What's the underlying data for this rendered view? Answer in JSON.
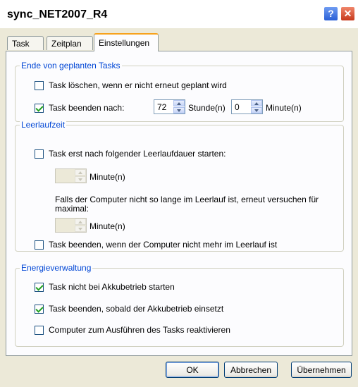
{
  "window": {
    "title": "sync_NET2007_R4",
    "help_label": "?",
    "close_label": "✕"
  },
  "tabs": [
    {
      "label": "Task"
    },
    {
      "label": "Zeitplan"
    },
    {
      "label": "Einstellungen"
    }
  ],
  "group_end": {
    "legend": "Ende von geplanten Tasks",
    "delete_label": "Task löschen, wenn er nicht erneut geplant wird",
    "delete_checked": false,
    "stop_label": "Task beenden nach:",
    "stop_checked": true,
    "hours_value": "72",
    "hours_label": "Stunde(n)",
    "minutes_value": "0",
    "minutes_label": "Minute(n)"
  },
  "group_idle": {
    "legend": "Leerlaufzeit",
    "start_label": "Task erst nach folgender Leerlaufdauer starten:",
    "start_checked": false,
    "wait_minutes_label": "Minute(n)",
    "retry_text": "Falls der Computer nicht so lange im Leerlauf ist, erneut versuchen für maximal:",
    "retry_minutes_label": "Minute(n)",
    "stop_label": "Task beenden, wenn der Computer nicht mehr im Leerlauf ist",
    "stop_checked": false
  },
  "group_power": {
    "legend": "Energieverwaltung",
    "no_battery_label": "Task nicht bei Akkubetrieb starten",
    "no_battery_checked": true,
    "stop_battery_label": "Task beenden, sobald der Akkubetrieb einsetzt",
    "stop_battery_checked": true,
    "wake_label": "Computer zum Ausführen des Tasks reaktivieren",
    "wake_checked": false
  },
  "buttons": {
    "ok": "OK",
    "cancel": "Abbrechen",
    "apply": "Übernehmen"
  },
  "colors": {
    "accent_tab": "#f7a21d",
    "group_legend": "#0046d5",
    "check_mark": "#21a121"
  }
}
